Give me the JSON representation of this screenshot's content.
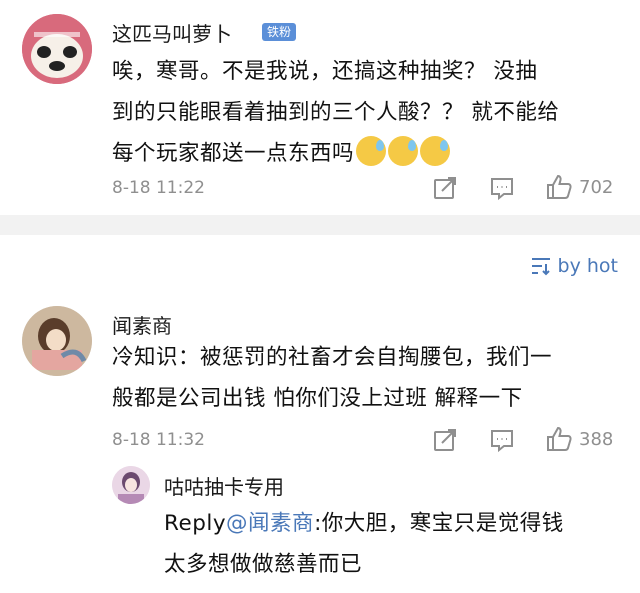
{
  "comments": [
    {
      "user": "这匹马叫萝卜",
      "badge": "铁粉",
      "text_line1": "唉，寒哥。不是我说，还搞这种抽奖？ 没抽",
      "text_line2": "到的只能眼看着抽到的三个人酸？？ 就不能给",
      "text_line3": "每个玩家都送一点东西吗",
      "emoji": "cold-sweat-face",
      "time": "8-18 11:22",
      "likes": "702"
    },
    {
      "user": "闻素商",
      "text_line1": "冷知识：被惩罚的社畜才会自掏腰包，我们一",
      "text_line2": "般都是公司出钱 怕你们没上过班 解释一下",
      "time": "8-18 11:32",
      "likes": "388"
    }
  ],
  "sort": {
    "label": "by hot"
  },
  "reply": {
    "user": "咕咕抽卡专用",
    "prefix": "Reply",
    "mention": "@闻素商",
    "text_line1": ":你大胆，寒宝只是觉得钱",
    "text_line2": "太多想做做慈善而已"
  },
  "colors": {
    "link_blue": "#4a78b8",
    "meta_gray": "#8f8f8f",
    "badge_blue": "#5b8fd8",
    "divider_gray": "#f2f2f2"
  }
}
